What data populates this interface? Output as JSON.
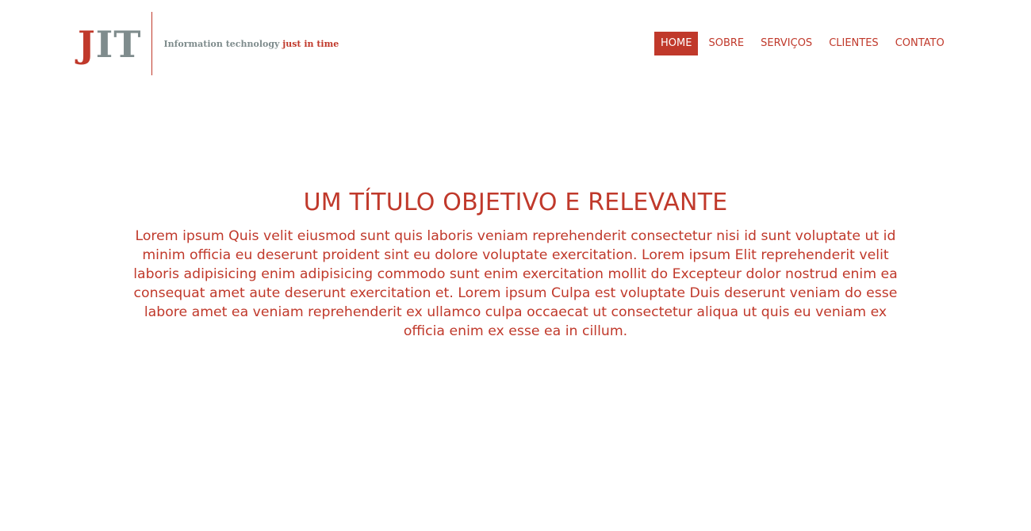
{
  "brand": {
    "logo_j": "J",
    "logo_it": "IT",
    "tagline_main": "Information technology",
    "tagline_accent": "just in time"
  },
  "nav": {
    "items": [
      {
        "label": "HOME",
        "active": true
      },
      {
        "label": "SOBRE",
        "active": false
      },
      {
        "label": "SERVIÇOS",
        "active": false
      },
      {
        "label": "CLIENTES",
        "active": false
      },
      {
        "label": "CONTATO",
        "active": false
      }
    ]
  },
  "hero": {
    "title": "UM TÍTULO OBJETIVO E RELEVANTE",
    "text": "Lorem ipsum Quis velit eiusmod sunt quis laboris veniam reprehenderit consectetur nisi id sunt voluptate ut id minim officia eu deserunt proident sint eu dolore voluptate exercitation. Lorem ipsum Elit reprehenderit velit laboris adipisicing enim adipisicing commodo sunt enim exercitation mollit do Excepteur dolor nostrud enim ea consequat amet aute deserunt exercitation et. Lorem ipsum Culpa est voluptate Duis deserunt veniam do esse labore amet ea veniam reprehenderit ex ullamco culpa occaecat ut consectetur aliqua ut quis eu veniam ex officia enim ex esse ea in cillum."
  },
  "colors": {
    "accent": "#c0392b",
    "gray": "#7f8c8d",
    "background": "#ffffff"
  }
}
